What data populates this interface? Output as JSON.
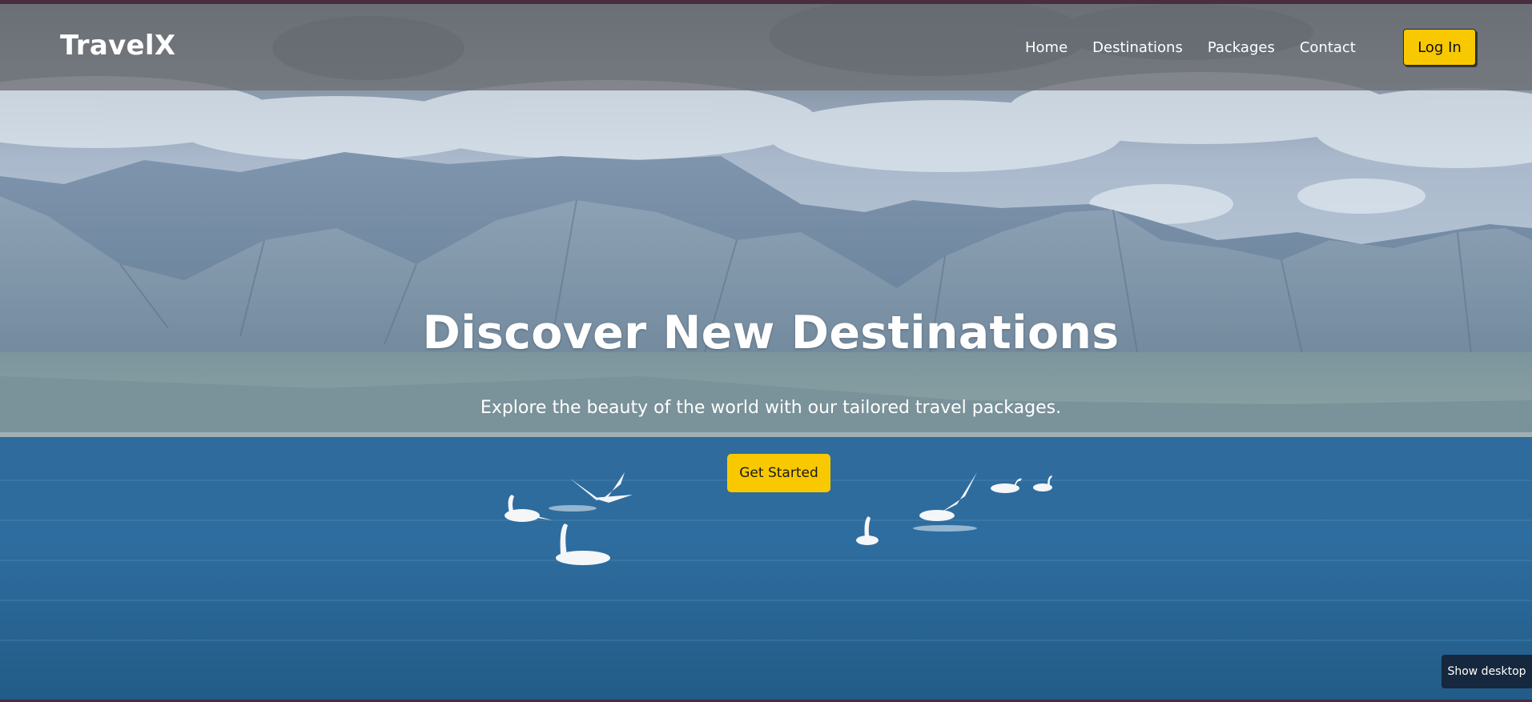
{
  "navbar": {
    "brand": "TravelX",
    "links": [
      "Home",
      "Destinations",
      "Packages",
      "Contact"
    ],
    "login_label": "Log In"
  },
  "hero": {
    "title": "Discover New Destinations",
    "subtitle": "Explore the beauty of the world with our tailored travel packages.",
    "cta_label": "Get Started"
  },
  "os": {
    "show_desktop_tooltip": "Show desktop"
  },
  "colors": {
    "accent": "#f8c800",
    "navbar_bg": "#6e7073",
    "sky": "#b9c9db",
    "mountain": "#6f8aa6",
    "water": "#2a6a9e"
  }
}
